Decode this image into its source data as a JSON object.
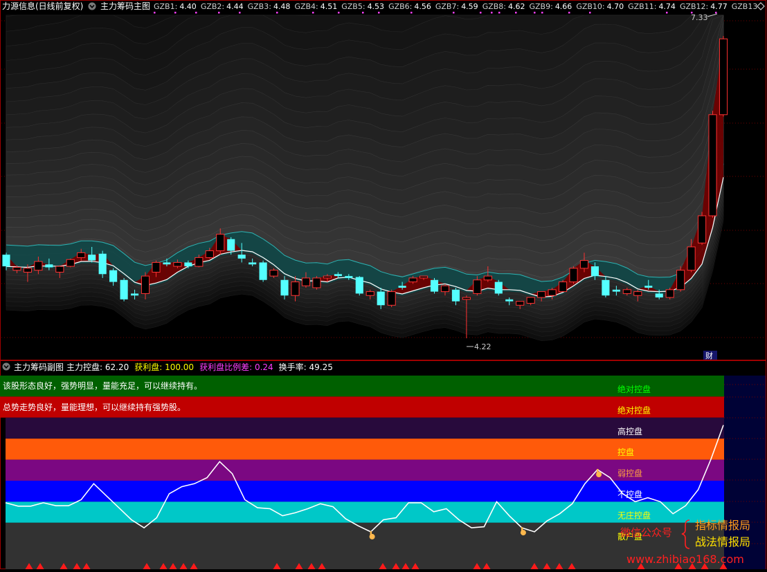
{
  "main_panel": {
    "title": "力源信息(日线前复权)",
    "indicator_name": "主力筹码主图",
    "gzb_labels": [
      {
        "name": "GZB1",
        "value": "4.40"
      },
      {
        "name": "GZB2",
        "value": "4.44"
      },
      {
        "name": "GZB3",
        "value": "4.48"
      },
      {
        "name": "GZB4",
        "value": "4.51"
      },
      {
        "name": "GZB5",
        "value": "4.53"
      },
      {
        "name": "GZB6",
        "value": "4.56"
      },
      {
        "name": "GZB7",
        "value": "4.59"
      },
      {
        "name": "GZB8",
        "value": "4.62"
      },
      {
        "name": "GZB9",
        "value": "4.66"
      },
      {
        "name": "GZB10",
        "value": "4.70"
      },
      {
        "name": "GZB11",
        "value": "4.74"
      },
      {
        "name": "GZB12",
        "value": "4.77"
      },
      {
        "name": "GZB13",
        "value": ""
      }
    ],
    "high_label": "7.33",
    "low_label": "4.22",
    "corner_badge": "财"
  },
  "sub_panel": {
    "indicator_name": "主力筹码副图",
    "stats": [
      {
        "label": "主力控盘:",
        "value": "62.20",
        "color": "#ffffff"
      },
      {
        "label": "获利盘:",
        "value": "100.00",
        "color": "#ffff00"
      },
      {
        "label": "获利盘比例差:",
        "value": "0.24",
        "color": "#ff3fff"
      },
      {
        "label": "换手率:",
        "value": "49.25",
        "color": "#ffffff"
      }
    ],
    "comment_line1": "该股形态良好，强势明显，量能充足，可以继续持有。",
    "comment_line2": "总势走势良好，量能理想，可以继续持有强势股。",
    "bands": [
      {
        "label": "绝对控盘",
        "color": "#006000",
        "label_color": "#00ff00"
      },
      {
        "label": "绝对控盘",
        "color": "#c00000",
        "label_color": "#ffff00"
      },
      {
        "label": "高控盘",
        "color": "#280a3c",
        "label_color": "#ffffff"
      },
      {
        "label": "控盘",
        "color": "#ff5a0a",
        "label_color": "#ffff00"
      },
      {
        "label": "弱控盘",
        "color": "#7b0882",
        "label_color": "#ffa040"
      },
      {
        "label": "不控盘",
        "color": "#0000ff",
        "label_color": "#ffffff"
      },
      {
        "label": "无庄控盘",
        "color": "#00c8c8",
        "label_color": "#ffff00"
      },
      {
        "label": "散户盘",
        "color": "#323232",
        "label_color": "#ffff00"
      }
    ]
  },
  "watermark": {
    "prefix": "微信公众号",
    "line1": "指标情报局",
    "line2": "战法情报局",
    "url": "www.zhibiao168.com"
  },
  "chart_data": [
    {
      "type": "candlestick",
      "title": "主力筹码主图",
      "ylim": [
        4.0,
        7.6
      ],
      "annotations": {
        "max": 7.33,
        "min": 4.22
      },
      "candles": [
        {
          "o": 5.08,
          "h": 5.1,
          "c": 4.96,
          "l": 4.92
        },
        {
          "o": 4.92,
          "h": 4.97,
          "c": 4.95,
          "l": 4.89
        },
        {
          "o": 4.9,
          "h": 4.98,
          "c": 4.94,
          "l": 4.8
        },
        {
          "o": 4.92,
          "h": 5.06,
          "c": 5.01,
          "l": 4.88
        },
        {
          "o": 4.98,
          "h": 5.04,
          "c": 4.95,
          "l": 4.92
        },
        {
          "o": 4.9,
          "h": 4.97,
          "c": 4.96,
          "l": 4.84
        },
        {
          "o": 4.96,
          "h": 5.04,
          "c": 5.03,
          "l": 4.95
        },
        {
          "o": 5.05,
          "h": 5.14,
          "c": 5.1,
          "l": 5.02
        },
        {
          "o": 5.08,
          "h": 5.16,
          "c": 5.02,
          "l": 5.0
        },
        {
          "o": 5.09,
          "h": 5.12,
          "c": 4.88,
          "l": 4.84
        },
        {
          "o": 4.92,
          "h": 4.94,
          "c": 4.8,
          "l": 4.76
        },
        {
          "o": 4.82,
          "h": 4.84,
          "c": 4.62,
          "l": 4.6
        },
        {
          "o": 4.68,
          "h": 4.72,
          "c": 4.66,
          "l": 4.62
        },
        {
          "o": 4.68,
          "h": 4.9,
          "c": 4.86,
          "l": 4.62
        },
        {
          "o": 4.9,
          "h": 5.02,
          "c": 5.0,
          "l": 4.85
        },
        {
          "o": 5.0,
          "h": 5.04,
          "c": 4.98,
          "l": 4.96
        },
        {
          "o": 4.96,
          "h": 5.03,
          "c": 5.0,
          "l": 4.94
        },
        {
          "o": 5.0,
          "h": 5.02,
          "c": 4.96,
          "l": 4.94
        },
        {
          "o": 4.96,
          "h": 5.08,
          "c": 5.05,
          "l": 4.95
        },
        {
          "o": 5.05,
          "h": 5.15,
          "c": 5.12,
          "l": 5.04
        },
        {
          "o": 5.12,
          "h": 5.35,
          "c": 5.29,
          "l": 5.08
        },
        {
          "o": 5.24,
          "h": 5.26,
          "c": 5.12,
          "l": 5.08
        },
        {
          "o": 5.08,
          "h": 5.2,
          "c": 5.04,
          "l": 5.0
        },
        {
          "o": 5.0,
          "h": 5.04,
          "c": 4.98,
          "l": 4.96
        },
        {
          "o": 5.0,
          "h": 5.02,
          "c": 4.82,
          "l": 4.8
        },
        {
          "o": 4.86,
          "h": 4.94,
          "c": 4.92,
          "l": 4.84
        },
        {
          "o": 4.82,
          "h": 4.86,
          "c": 4.66,
          "l": 4.62
        },
        {
          "o": 4.66,
          "h": 4.86,
          "c": 4.8,
          "l": 4.6
        },
        {
          "o": 4.76,
          "h": 4.9,
          "c": 4.84,
          "l": 4.74
        },
        {
          "o": 4.74,
          "h": 4.86,
          "c": 4.84,
          "l": 4.72
        },
        {
          "o": 4.84,
          "h": 4.88,
          "c": 4.86,
          "l": 4.8
        },
        {
          "o": 4.88,
          "h": 4.9,
          "c": 4.86,
          "l": 4.84
        },
        {
          "o": 4.86,
          "h": 4.88,
          "c": 4.84,
          "l": 4.82
        },
        {
          "o": 4.85,
          "h": 4.86,
          "c": 4.68,
          "l": 4.66
        },
        {
          "o": 4.66,
          "h": 4.72,
          "c": 4.7,
          "l": 4.62
        },
        {
          "o": 4.7,
          "h": 4.74,
          "c": 4.56,
          "l": 4.52
        },
        {
          "o": 4.56,
          "h": 4.72,
          "c": 4.7,
          "l": 4.54
        },
        {
          "o": 4.76,
          "h": 4.8,
          "c": 4.74,
          "l": 4.72
        },
        {
          "o": 4.8,
          "h": 4.86,
          "c": 4.84,
          "l": 4.78
        },
        {
          "o": 4.84,
          "h": 4.86,
          "c": 4.86,
          "l": 4.82
        },
        {
          "o": 4.82,
          "h": 4.84,
          "c": 4.7,
          "l": 4.68
        },
        {
          "o": 4.7,
          "h": 4.78,
          "c": 4.76,
          "l": 4.66
        },
        {
          "o": 4.72,
          "h": 4.74,
          "c": 4.6,
          "l": 4.56
        },
        {
          "o": 4.62,
          "h": 4.66,
          "c": 4.64,
          "l": 4.22
        },
        {
          "o": 4.68,
          "h": 4.86,
          "c": 4.82,
          "l": 4.66
        },
        {
          "o": 4.82,
          "h": 4.96,
          "c": 4.86,
          "l": 4.8
        },
        {
          "o": 4.8,
          "h": 4.82,
          "c": 4.68,
          "l": 4.66
        },
        {
          "o": 4.62,
          "h": 4.64,
          "c": 4.6,
          "l": 4.56
        },
        {
          "o": 4.56,
          "h": 4.6,
          "c": 4.6,
          "l": 4.52
        },
        {
          "o": 4.58,
          "h": 4.64,
          "c": 4.64,
          "l": 4.56
        },
        {
          "o": 4.64,
          "h": 4.7,
          "c": 4.7,
          "l": 4.6
        },
        {
          "o": 4.66,
          "h": 4.74,
          "c": 4.72,
          "l": 4.62
        },
        {
          "o": 4.7,
          "h": 4.82,
          "c": 4.8,
          "l": 4.7
        },
        {
          "o": 4.8,
          "h": 4.96,
          "c": 4.94,
          "l": 4.78
        },
        {
          "o": 4.94,
          "h": 5.1,
          "c": 5.02,
          "l": 4.9
        },
        {
          "o": 4.96,
          "h": 5.0,
          "c": 4.86,
          "l": 4.82
        },
        {
          "o": 4.82,
          "h": 4.86,
          "c": 4.66,
          "l": 4.64
        },
        {
          "o": 4.72,
          "h": 4.76,
          "c": 4.7,
          "l": 4.66
        },
        {
          "o": 4.68,
          "h": 4.74,
          "c": 4.72,
          "l": 4.66
        },
        {
          "o": 4.66,
          "h": 4.72,
          "c": 4.7,
          "l": 4.6
        },
        {
          "o": 4.76,
          "h": 4.82,
          "c": 4.74,
          "l": 4.72
        },
        {
          "o": 4.68,
          "h": 4.72,
          "c": 4.64,
          "l": 4.62
        },
        {
          "o": 4.64,
          "h": 4.74,
          "c": 4.72,
          "l": 4.62
        },
        {
          "o": 4.72,
          "h": 4.96,
          "c": 4.92,
          "l": 4.7
        },
        {
          "o": 4.92,
          "h": 5.24,
          "c": 5.16,
          "l": 4.9
        },
        {
          "o": 5.2,
          "h": 5.52,
          "c": 5.48,
          "l": 5.18
        },
        {
          "o": 5.48,
          "h": 6.56,
          "c": 6.52,
          "l": 5.46
        },
        {
          "o": 6.52,
          "h": 7.33,
          "c": 7.3,
          "l": 6.5
        }
      ]
    },
    {
      "type": "line",
      "title": "主力筹码副图",
      "ylim": [
        0,
        100
      ],
      "series": [
        {
          "name": "主力控盘",
          "values": [
            23.5,
            21.8,
            21.8,
            23.5,
            22.0,
            22.0,
            25.0,
            33.0,
            27.0,
            21.0,
            15.0,
            11.0,
            16.0,
            28.0,
            31.5,
            33.0,
            36.0,
            44.0,
            38.0,
            25.0,
            21.0,
            20.5,
            17.0,
            18.5,
            20.5,
            23.0,
            21.5,
            15.5,
            12.0,
            9.0,
            15.0,
            16.0,
            23.5,
            23.5,
            19.0,
            20.5,
            15.0,
            11.0,
            11.5,
            24.0,
            17.0,
            11.0,
            9.0,
            14.5,
            18.0,
            23.0,
            33.0,
            40.0,
            36.0,
            28.0,
            24.0,
            26.0,
            24.0,
            18.0,
            22.0,
            30.0,
            45.0,
            62.2
          ]
        }
      ],
      "bands": [
        "散户盘",
        "无庄控盘",
        "不控盘",
        "弱控盘",
        "控盘",
        "高控盘",
        "绝对控盘",
        "绝对控盘"
      ]
    }
  ]
}
